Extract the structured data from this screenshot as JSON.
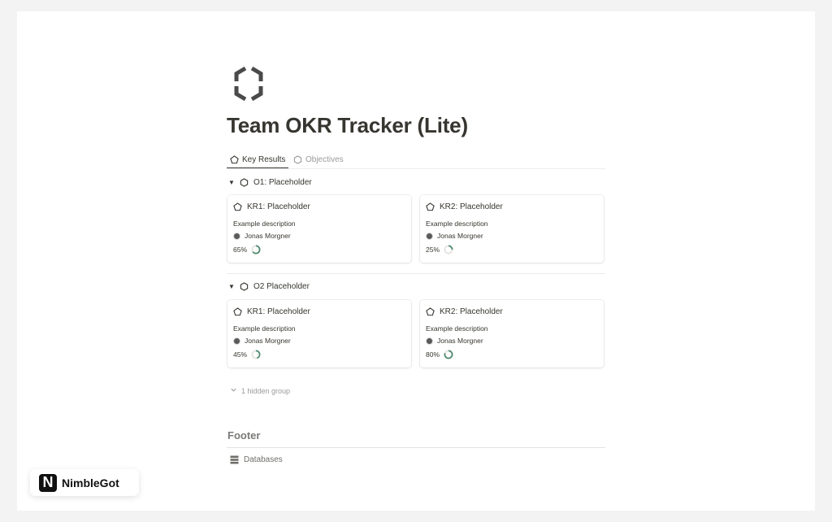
{
  "page": {
    "title": "Team OKR Tracker (Lite)",
    "icon": "hexagon-icon"
  },
  "tabs": [
    {
      "label": "Key Results",
      "icon": "key-result-icon",
      "active": true
    },
    {
      "label": "Objectives",
      "icon": "objective-icon",
      "active": false
    }
  ],
  "groups": [
    {
      "name": "O1: Placeholder",
      "cards": [
        {
          "title": "KR1: Placeholder",
          "description": "Example description",
          "owner": "Jonas Morgner",
          "progress_label": "65%",
          "progress": 0.65
        },
        {
          "title": "KR2: Placeholder",
          "description": "Example description",
          "owner": "Jonas Morgner",
          "progress_label": "25%",
          "progress": 0.25
        }
      ]
    },
    {
      "name": "O2 Placeholder",
      "cards": [
        {
          "title": "KR1: Placeholder",
          "description": "Example description",
          "owner": "Jonas Morgner",
          "progress_label": "45%",
          "progress": 0.45
        },
        {
          "title": "KR2: Placeholder",
          "description": "Example description",
          "owner": "Jonas Morgner",
          "progress_label": "80%",
          "progress": 0.8
        }
      ]
    }
  ],
  "hidden_group_label": "1 hidden group",
  "footer": {
    "title": "Footer",
    "link": "Databases"
  },
  "brand": {
    "logo_letter": "N",
    "name": "NimbleGot"
  },
  "colors": {
    "progress_ring": "#4f8a6f",
    "progress_track": "#e3e3e0",
    "text": "#37352f",
    "muted": "#9b9a97"
  }
}
